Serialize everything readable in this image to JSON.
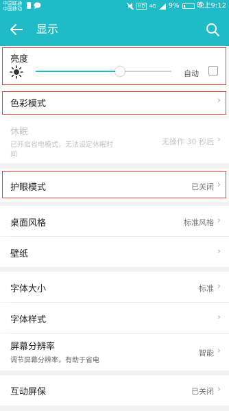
{
  "status_bar": {
    "carrier_1": "中国联通",
    "carrier_2": "中国移动",
    "hd_label": "HD",
    "signal_label": "4G",
    "battery_percent": "9%",
    "time": "晚上9:12"
  },
  "app_bar": {
    "title": "显示",
    "back_icon": "arrow-left-icon",
    "search_icon": "search-icon"
  },
  "brightness": {
    "label": "亮度",
    "auto_label": "自动",
    "level_fraction": 0.62,
    "auto_checked": false,
    "icon": "brightness-icon"
  },
  "rows": {
    "color_mode": {
      "label": "色彩模式"
    },
    "sleep": {
      "label": "休眠",
      "subtitle_line1": "已开启省电模式，无法设定休眠时",
      "subtitle_line2": "间",
      "value": "无操作 30 秒后",
      "disabled": true
    },
    "eye_comfort": {
      "label": "护眼模式",
      "value": "已关闭"
    },
    "desktop_style": {
      "label": "桌面风格",
      "value": "标准风格"
    },
    "wallpaper": {
      "label": "壁纸"
    },
    "font_size": {
      "label": "字体大小",
      "value": "标准"
    },
    "font_style": {
      "label": "字体样式"
    },
    "resolution": {
      "label": "屏幕分辨率",
      "subtitle": "调节屏幕分辨率，有助于省电",
      "value": "智能"
    },
    "screensaver": {
      "label": "互动屏保",
      "value": "已关闭"
    }
  },
  "chevron": "›",
  "colors": {
    "accent": "#1fbcc8",
    "highlight_box": "#e53935"
  }
}
